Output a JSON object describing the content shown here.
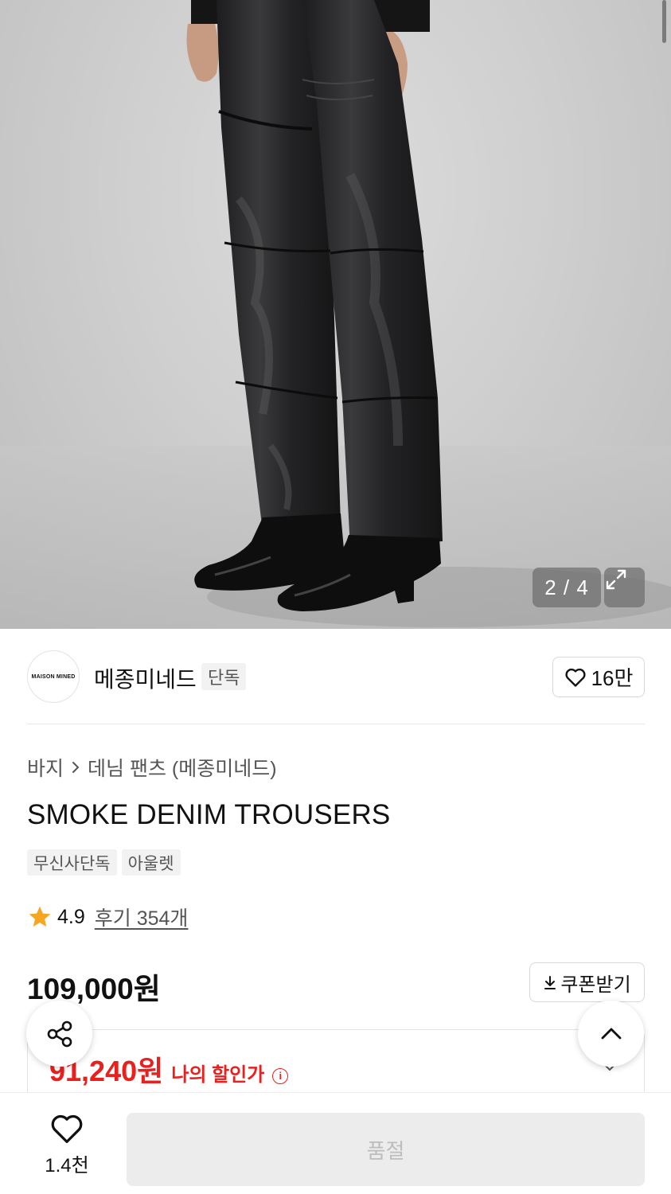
{
  "gallery": {
    "counter": "2 / 4",
    "image_alt": "model wearing black smoke denim trousers and black boots"
  },
  "brand": {
    "logo_text": "MAISON MINED",
    "name": "메종미네드",
    "badge": "단독",
    "likes": "16만"
  },
  "breadcrumb": {
    "category": "바지",
    "subcategory": "데님 팬츠 (메종미네드)"
  },
  "product": {
    "title": "SMOKE DENIM TROUSERS",
    "tags": [
      "무신사단독",
      "아울렛"
    ],
    "rating": "4.9",
    "reviews": "후기 354개",
    "price": "109,000원",
    "coupon_label": "쿠폰받기",
    "sale_price": "91,240원",
    "sale_label": "나의 할인가"
  },
  "bottom": {
    "wish_count": "1.4천",
    "buy_label": "품절"
  },
  "colors": {
    "sale_red": "#e8201e",
    "disabled_bg": "#ececec"
  },
  "icons": [
    "expand-icon",
    "heart-icon",
    "star-icon",
    "download-icon",
    "info-icon",
    "share-icon",
    "chevron-up-icon",
    "chevron-down-icon",
    "chevron-right-icon"
  ]
}
